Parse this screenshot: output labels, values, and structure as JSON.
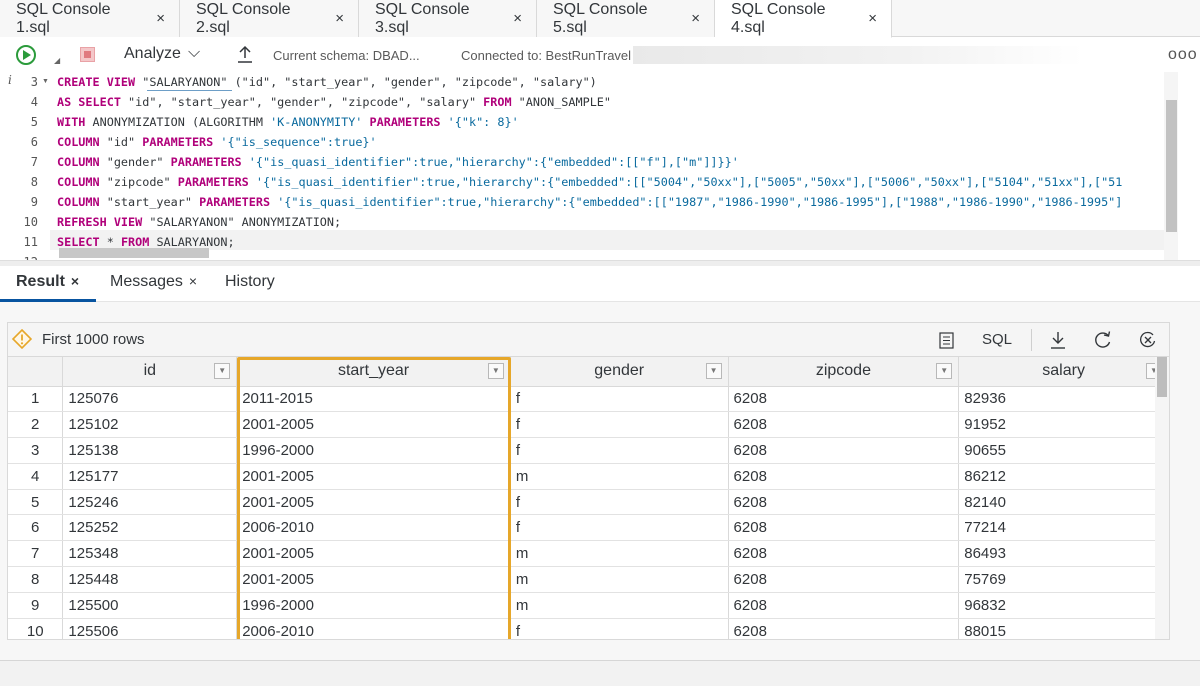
{
  "tabs": [
    {
      "label": "SQL Console 1.sql",
      "close": "×"
    },
    {
      "label": "SQL Console 2.sql",
      "close": "×"
    },
    {
      "label": "SQL Console 3.sql",
      "close": "×"
    },
    {
      "label": "SQL Console 5.sql",
      "close": "×"
    },
    {
      "label": "SQL Console 4.sql",
      "close": "×",
      "active": true
    }
  ],
  "toolbar": {
    "analyze_label": "Analyze",
    "analyze_caret": "⌵",
    "schema": "Current schema: DBAD...",
    "connected": "Connected to: BestRunTravel",
    "more": "ooo"
  },
  "editor": {
    "info_marker": "i",
    "line_numbers": [
      "3",
      "4",
      "5",
      "6",
      "7",
      "8",
      "9",
      "10",
      "11",
      "12"
    ],
    "lines": [
      [
        {
          "t": "CREATE VIEW ",
          "k": "kw"
        },
        {
          "t": "\"SALARYANON\" (\"id\", \"start_year\", \"gender\", \"zipcode\", \"salary\")",
          "k": ""
        }
      ],
      [
        {
          "t": "AS SELECT ",
          "k": "kw"
        },
        {
          "t": "\"id\", \"start_year\", \"gender\", \"zipcode\", \"salary\" ",
          "k": ""
        },
        {
          "t": "FROM ",
          "k": "kw"
        },
        {
          "t": "\"ANON_SAMPLE\"",
          "k": ""
        }
      ],
      [
        {
          "t": "WITH ",
          "k": "kw"
        },
        {
          "t": "ANONYMIZATION (ALGORITHM ",
          "k": ""
        },
        {
          "t": "'K-ANONYMITY' ",
          "k": "str"
        },
        {
          "t": "PARAMETERS ",
          "k": "kw"
        },
        {
          "t": "'{\"k\": 8}'",
          "k": "str"
        }
      ],
      [
        {
          "t": "COLUMN ",
          "k": "kw"
        },
        {
          "t": "\"id\" ",
          "k": ""
        },
        {
          "t": "PARAMETERS ",
          "k": "kw"
        },
        {
          "t": "'{\"is_sequence\":true}'",
          "k": "str"
        }
      ],
      [
        {
          "t": "COLUMN ",
          "k": "kw"
        },
        {
          "t": "\"gender\" ",
          "k": ""
        },
        {
          "t": "PARAMETERS ",
          "k": "kw"
        },
        {
          "t": "'{\"is_quasi_identifier\":true,\"hierarchy\":{\"embedded\":[[\"f\"],[\"m\"]]}}'",
          "k": "str"
        }
      ],
      [
        {
          "t": "COLUMN ",
          "k": "kw"
        },
        {
          "t": "\"zipcode\" ",
          "k": ""
        },
        {
          "t": "PARAMETERS ",
          "k": "kw"
        },
        {
          "t": "'{\"is_quasi_identifier\":true,\"hierarchy\":{\"embedded\":[[\"5004\",\"50xx\"],[\"5005\",\"50xx\"],[\"5006\",\"50xx\"],[\"5104\",\"51xx\"],[\"51",
          "k": "str"
        }
      ],
      [
        {
          "t": "COLUMN ",
          "k": "kw"
        },
        {
          "t": "\"start_year\" ",
          "k": ""
        },
        {
          "t": "PARAMETERS ",
          "k": "kw"
        },
        {
          "t": "'{\"is_quasi_identifier\":true,\"hierarchy\":{\"embedded\":[[\"1987\",\"1986-1990\",\"1986-1995\"],[\"1988\",\"1986-1990\",\"1986-1995\"]",
          "k": "str"
        }
      ],
      [
        {
          "t": "REFRESH VIEW ",
          "k": "kw"
        },
        {
          "t": "\"SALARYANON\" ANONYMIZATION;",
          "k": ""
        }
      ],
      [
        {
          "t": "SELECT ",
          "k": "kw"
        },
        {
          "t": "* ",
          "k": ""
        },
        {
          "t": "FROM ",
          "k": "kw"
        },
        {
          "t": "SALARYANON;",
          "k": ""
        }
      ],
      []
    ]
  },
  "result_tabs": [
    {
      "label": "Result",
      "close": "×",
      "active": true
    },
    {
      "label": "Messages",
      "close": "×"
    },
    {
      "label": "History",
      "close": ""
    }
  ],
  "grid": {
    "status": "First 1000 rows",
    "sql_label": "SQL",
    "columns": [
      "",
      "id",
      "start_year",
      "gender",
      "zipcode",
      "salary"
    ],
    "rows": [
      [
        "1",
        "125076",
        "2011-2015",
        "f",
        "6208",
        "82936"
      ],
      [
        "2",
        "125102",
        "2001-2005",
        "f",
        "6208",
        "91952"
      ],
      [
        "3",
        "125138",
        "1996-2000",
        "f",
        "6208",
        "90655"
      ],
      [
        "4",
        "125177",
        "2001-2005",
        "m",
        "6208",
        "86212"
      ],
      [
        "5",
        "125246",
        "2001-2005",
        "f",
        "6208",
        "82140"
      ],
      [
        "6",
        "125252",
        "2006-2010",
        "f",
        "6208",
        "77214"
      ],
      [
        "7",
        "125348",
        "2001-2005",
        "m",
        "6208",
        "86493"
      ],
      [
        "8",
        "125448",
        "2001-2005",
        "m",
        "6208",
        "75769"
      ],
      [
        "9",
        "125500",
        "1996-2000",
        "m",
        "6208",
        "96832"
      ],
      [
        "10",
        "125506",
        "2006-2010",
        "f",
        "6208",
        "88015"
      ]
    ]
  },
  "colors": {
    "run_green": "#2b9b3b",
    "keyword": "#b0007a",
    "string": "#0a6a9e",
    "highlight": "#e6a72a",
    "active_tab_underline": "#0854a0"
  }
}
